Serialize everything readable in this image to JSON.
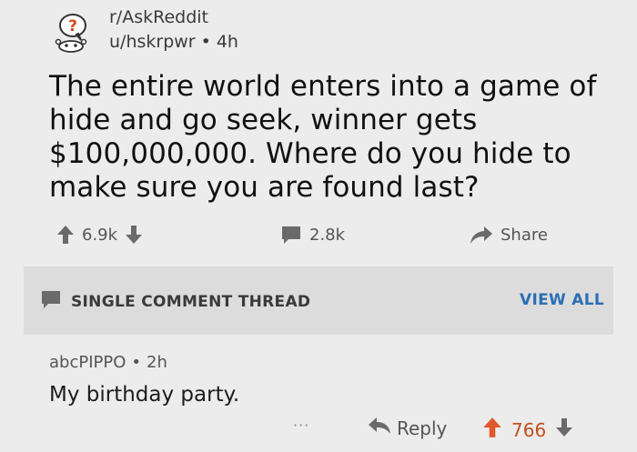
{
  "post": {
    "subreddit": "r/AskReddit",
    "author": "u/hskrpwr",
    "separator": "•",
    "age": "4h",
    "title": "The entire world enters into a game of hide and go seek, winner gets $100,000,000. Where do you hide to make sure you are found last?",
    "score": "6.9k",
    "comment_count": "2.8k",
    "share_label": "Share"
  },
  "thread_bar": {
    "label": "SINGLE COMMENT THREAD",
    "view_all": "VIEW ALL"
  },
  "comment": {
    "author": "abcPIPPO",
    "separator": "•",
    "age": "2h",
    "body": "My birthday party.",
    "more": "···",
    "reply_label": "Reply",
    "score": "766"
  },
  "colors": {
    "background": "#ececec",
    "thread_bar": "#dcdcdc",
    "link_blue": "#2a6fb3",
    "upvote_orange": "#e2572a",
    "icon_gray": "#6a6a6a"
  }
}
